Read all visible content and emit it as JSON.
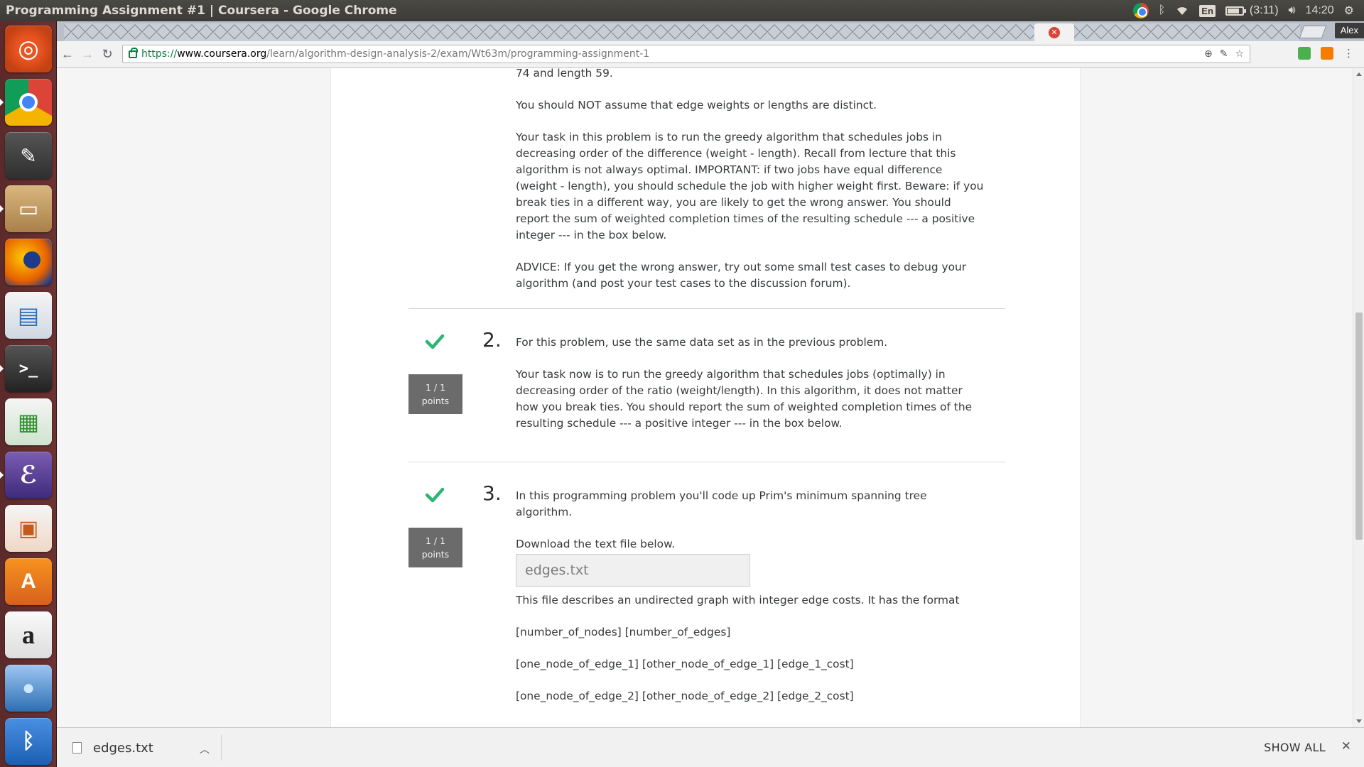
{
  "window": {
    "title": "Programming Assignment #1 | Coursera - Google Chrome"
  },
  "tray": {
    "keyboard": "En",
    "battery": "(3:11)",
    "clock": "14:20"
  },
  "browser": {
    "profile": "Alex",
    "url_scheme": "https://",
    "url_host": "www.coursera.org",
    "url_path": "/learn/algorithm-design-analysis-2/exam/Wt63m/programming-assignment-1"
  },
  "launcher": {
    "items": [
      {
        "name": "ubuntu-dash-icon",
        "glyph": "◎"
      },
      {
        "name": "chrome-icon",
        "glyph": ""
      },
      {
        "name": "gimp-icon",
        "glyph": "✎"
      },
      {
        "name": "files-icon",
        "glyph": "▭"
      },
      {
        "name": "firefox-icon",
        "glyph": ""
      },
      {
        "name": "writer-icon",
        "glyph": "▤"
      },
      {
        "name": "terminal-icon",
        "glyph": ">_"
      },
      {
        "name": "calc-icon",
        "glyph": "▦"
      },
      {
        "name": "emacs-icon",
        "glyph": "ℰ"
      },
      {
        "name": "impress-icon",
        "glyph": "▣"
      },
      {
        "name": "software-center-icon",
        "glyph": "A"
      },
      {
        "name": "amazon-icon",
        "glyph": "a"
      },
      {
        "name": "droplet-icon",
        "glyph": "●"
      },
      {
        "name": "bluetooth-icon",
        "glyph": "ᛒ"
      }
    ]
  },
  "page": {
    "q1_text": {
      "p_cut": "74 and length 59.",
      "p1": "You should NOT assume that edge weights or lengths are distinct.",
      "p2": "Your task in this problem is to run the greedy algorithm that schedules jobs in decreasing order of the difference (weight - length). Recall from lecture that this algorithm is not always optimal. IMPORTANT: if two jobs have equal difference (weight - length), you should schedule the job with higher weight first. Beware: if you break ties in a different way, you are likely to get the wrong answer. You should report the sum of weighted completion times of the resulting schedule --- a positive integer --- in the box below.",
      "p3": "ADVICE: If you get the wrong answer, try out some small test cases to debug your algorithm (and post your test cases to the discussion forum)."
    },
    "q2": {
      "number": "2.",
      "points_line1": "1 / 1",
      "points_line2": "points",
      "p1": "For this problem, use the same data set as in the previous problem.",
      "p2": "Your task now is to run the greedy algorithm that schedules jobs (optimally) in decreasing order of the ratio (weight/length). In this algorithm, it does not matter how you break ties. You should report the sum of weighted completion times of the resulting schedule --- a positive integer --- in the box below."
    },
    "q3": {
      "number": "3.",
      "points_line1": "1 / 1",
      "points_line2": "points",
      "p1": "In this programming problem you'll code up Prim's minimum spanning tree algorithm.",
      "p2": "Download the text file below.",
      "file_link": "edges.txt",
      "p3": "This file describes an undirected graph with integer edge costs. It has the format",
      "p4": "[number_of_nodes] [number_of_edges]",
      "p5": "[one_node_of_edge_1] [other_node_of_edge_1] [edge_1_cost]",
      "p6": "[one_node_of_edge_2] [other_node_of_edge_2] [edge_2_cost]"
    }
  },
  "downloads": {
    "file_name": "edges.txt",
    "show_all": "SHOW ALL"
  },
  "colors": {
    "check_green": "#2bb673",
    "launcher_bg": "#5b2a2a"
  }
}
